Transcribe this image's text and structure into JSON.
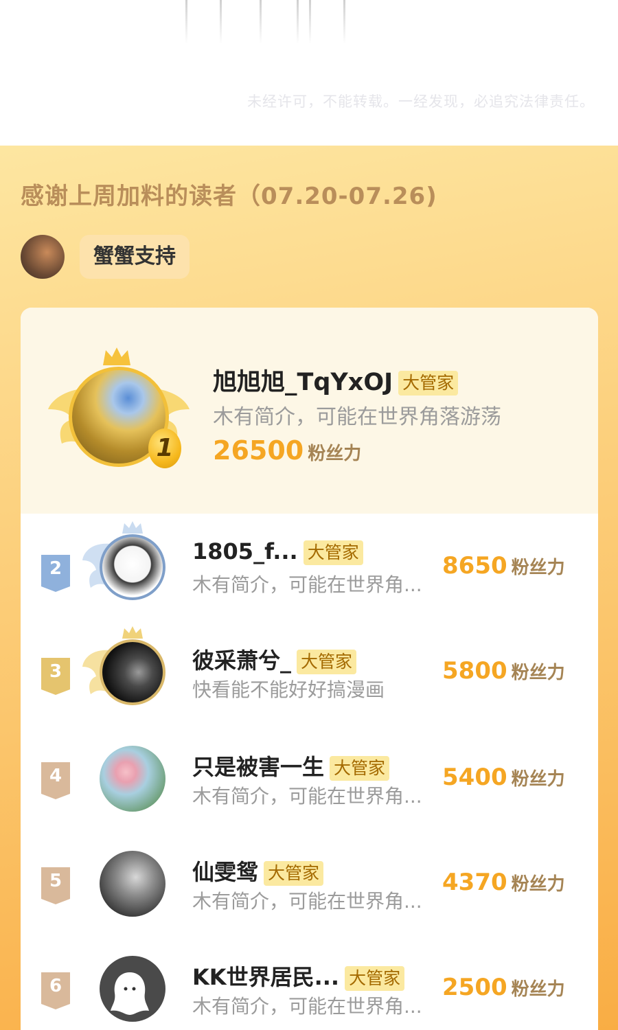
{
  "notice": "未经许可，不能转载。一经发现，必追究法律责任。",
  "title": "感谢上周加料的读者（07.20-07.26)",
  "support": {
    "label": "蟹蟹支持"
  },
  "score_unit": "粉丝力",
  "badge_label": "大管家",
  "first": {
    "rank": "1",
    "name": "旭旭旭_TqYxOJ",
    "bio": "木有简介，可能在世界角落游荡",
    "score": "26500"
  },
  "readers": [
    {
      "rank": "2",
      "name": "1805_f...",
      "bio": "木有简介，可能在世界角...",
      "score": "8650"
    },
    {
      "rank": "3",
      "name": "彼采萧兮_",
      "bio": "快看能不能好好搞漫画",
      "score": "5800"
    },
    {
      "rank": "4",
      "name": "只是被害一生",
      "bio": "木有简介，可能在世界角...",
      "score": "5400"
    },
    {
      "rank": "5",
      "name": "仙雯鸳",
      "bio": "木有简介，可能在世界角...",
      "score": "4370"
    },
    {
      "rank": "6",
      "name": "KK世界居民...",
      "bio": "木有简介，可能在世界角...",
      "score": "2500"
    }
  ],
  "colors": {
    "accent": "#f5a623",
    "background_gradient_top": "#fde6a1",
    "background_gradient_bottom": "#f9ad44"
  }
}
